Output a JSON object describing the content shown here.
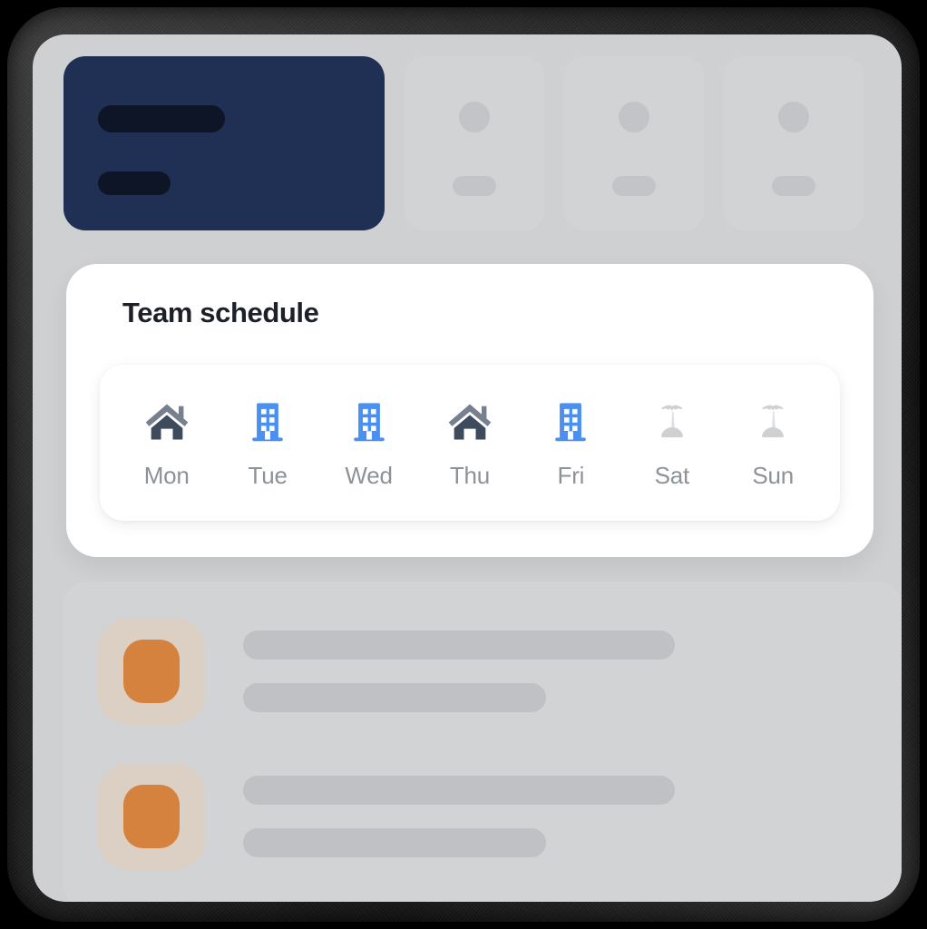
{
  "app": {
    "device": "tablet-frame",
    "background_color": "#cfd0d2",
    "bezel_color": "#1a1a1a"
  },
  "top_cards": {
    "primary": {
      "name": "primary-card",
      "color": "#1f3054",
      "placeholder_bar_color": "#0d1526"
    },
    "ghost_cards": [
      {
        "name": "ghost-card-1",
        "color": "#d2d3d5"
      },
      {
        "name": "ghost-card-2",
        "color": "#d2d3d5"
      },
      {
        "name": "ghost-card-3",
        "color": "#d2d3d5"
      }
    ]
  },
  "schedule": {
    "title": "Team schedule",
    "title_color": "#1c2028",
    "card_color": "#ffffff",
    "label_color": "#8d9299",
    "icon_colors": {
      "home_roof": "#76808e",
      "home_body": "#3e4b5c",
      "office": "#4a90f0",
      "office_window": "#ffffff",
      "vacation": "#cfd0d2",
      "vacation_trunk": "#dedfe1"
    },
    "days": [
      {
        "label": "Mon",
        "icon": "home-icon",
        "status": "remote"
      },
      {
        "label": "Tue",
        "icon": "office-icon",
        "status": "office"
      },
      {
        "label": "Wed",
        "icon": "office-icon",
        "status": "office"
      },
      {
        "label": "Thu",
        "icon": "home-icon",
        "status": "remote"
      },
      {
        "label": "Fri",
        "icon": "office-icon",
        "status": "office"
      },
      {
        "label": "Sat",
        "icon": "palm-tree-icon",
        "status": "off"
      },
      {
        "label": "Sun",
        "icon": "palm-tree-icon",
        "status": "off"
      }
    ]
  },
  "list": {
    "panel_color": "#d2d3d5",
    "avatar_bg_color": "#dccfc4",
    "avatar_color": "#d5823f",
    "line_color": "#c0c1c4",
    "rows": [
      {
        "name": "list-item-1"
      },
      {
        "name": "list-item-2"
      }
    ]
  }
}
